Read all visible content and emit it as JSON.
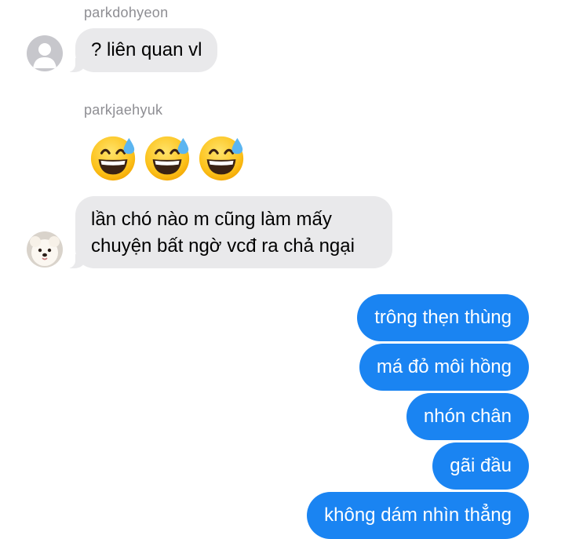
{
  "messages": [
    {
      "sender": "parkdohyeon",
      "text": "? liên quan vl"
    },
    {
      "sender": "parkjaehyuk",
      "emoji": [
        "grinning-face-with-sweat",
        "grinning-face-with-sweat",
        "grinning-face-with-sweat"
      ]
    },
    {
      "text_line1": "lần chó nào m cũng làm mấy",
      "text_line2": "chuyện bất ngờ vcđ ra chả ngại"
    }
  ],
  "outgoing": [
    "trông thẹn thùng",
    "má đỏ môi hồng",
    "nhón chân",
    "gãi đầu",
    "không dám nhìn thẳng"
  ],
  "colors": {
    "incoming_bubble": "#e9e9eb",
    "outgoing_bubble": "#1a84f2",
    "sender_label": "#8e8e93"
  },
  "icons": {
    "avatar_1": "default-person-avatar-icon",
    "avatar_2": "pomeranian-dog-avatar",
    "emoji": "grinning-face-with-sweat-emoji"
  }
}
